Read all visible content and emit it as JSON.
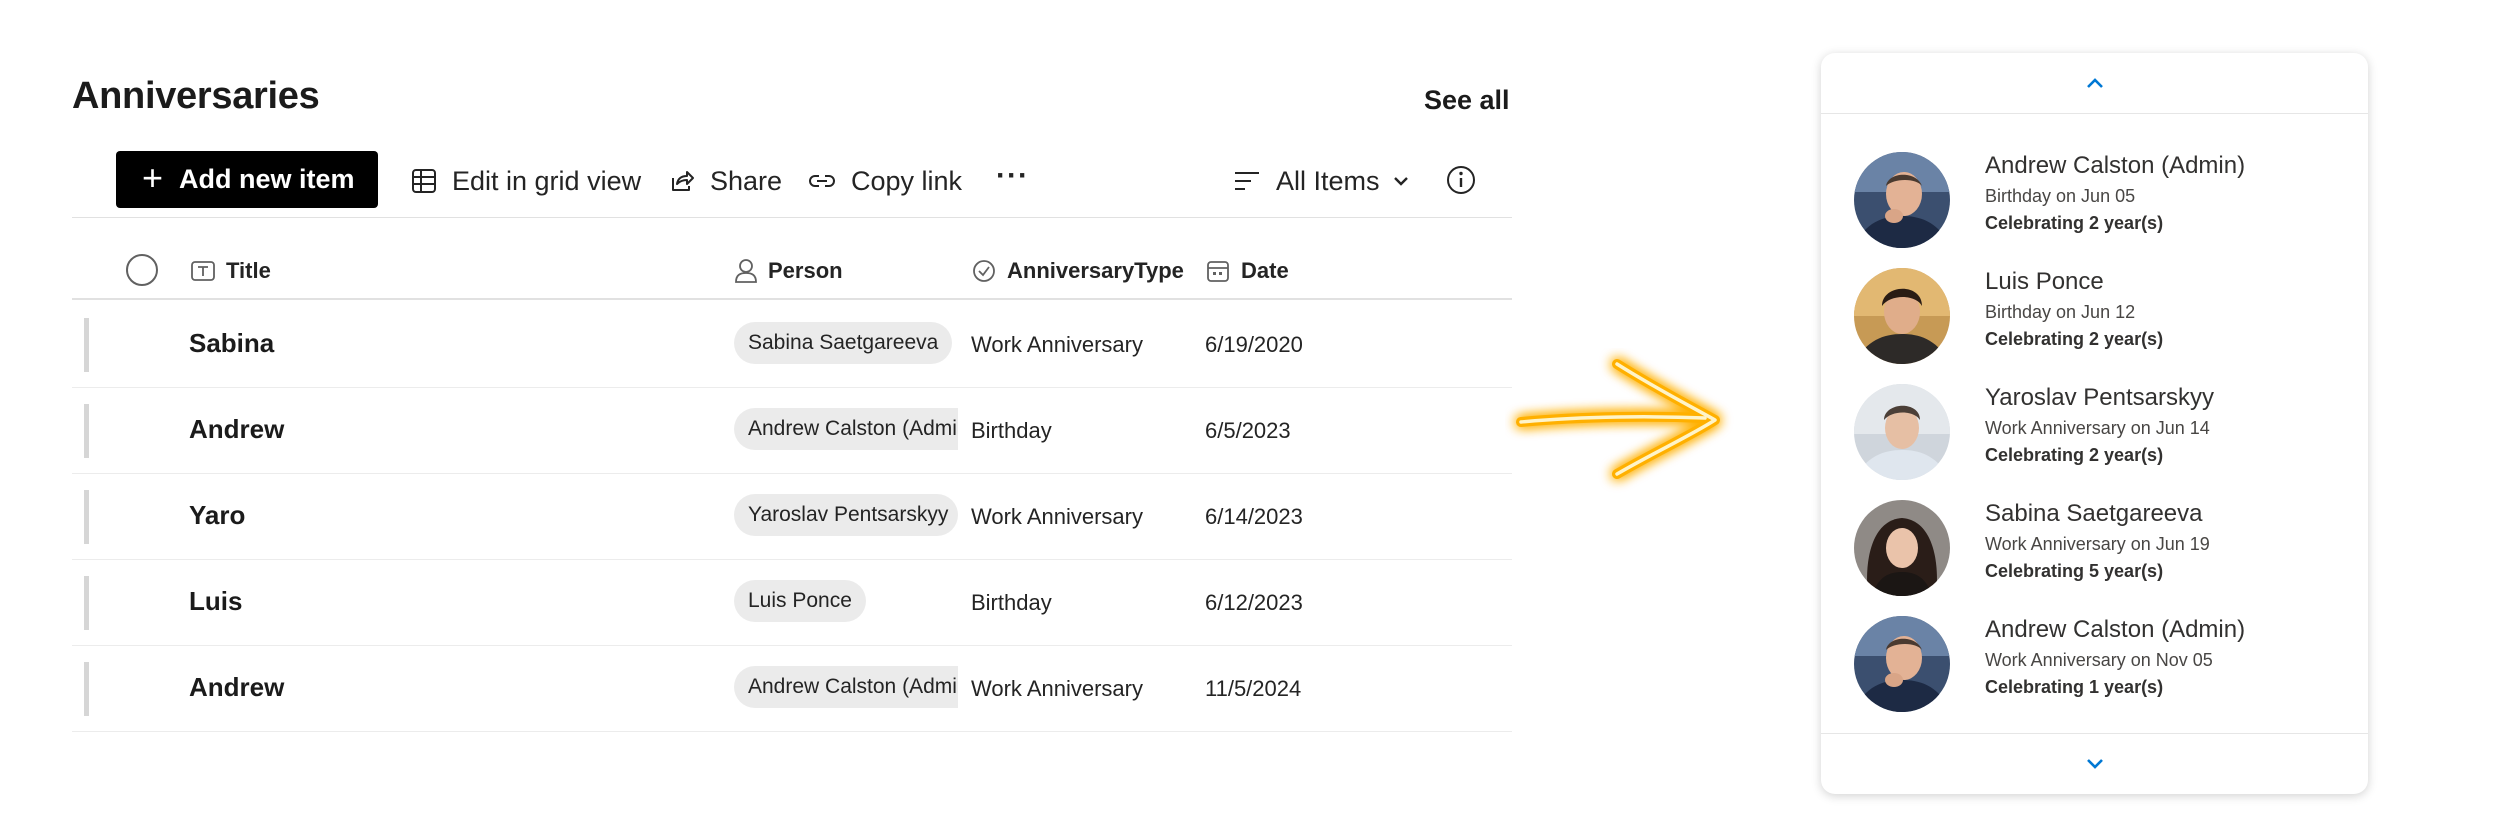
{
  "list": {
    "title": "Anniversaries",
    "see_all": "See all",
    "toolbar": {
      "add": "Add new item",
      "edit_grid": "Edit in grid view",
      "share": "Share",
      "copy_link": "Copy link",
      "more": "···",
      "view": "All Items"
    },
    "columns": {
      "title": "Title",
      "person": "Person",
      "type": "AnniversaryType",
      "date": "Date"
    },
    "rows": [
      {
        "title": "Sabina",
        "person": "Sabina Saetgareeva",
        "type": "Work Anniversary",
        "date": "6/19/2020"
      },
      {
        "title": "Andrew",
        "person": "Andrew Calston (Admin)",
        "type": "Birthday",
        "date": "6/5/2023"
      },
      {
        "title": "Yaro",
        "person": "Yaroslav Pentsarskyy",
        "type": "Work Anniversary",
        "date": "6/14/2023"
      },
      {
        "title": "Luis",
        "person": "Luis Ponce",
        "type": "Birthday",
        "date": "6/12/2023"
      },
      {
        "title": "Andrew",
        "person": "Andrew Calston (Admin)",
        "type": "Work Anniversary",
        "date": "11/5/2024"
      }
    ]
  },
  "card": {
    "people": [
      {
        "name": "Andrew Calston (Admin)",
        "event": "Birthday on Jun 05",
        "celebrating": "Celebrating 2 year(s)"
      },
      {
        "name": "Luis Ponce",
        "event": "Birthday on Jun 12",
        "celebrating": "Celebrating 2 year(s)"
      },
      {
        "name": "Yaroslav Pentsarskyy",
        "event": "Work Anniversary on Jun 14",
        "celebrating": "Celebrating 2 year(s)"
      },
      {
        "name": "Sabina Saetgareeva",
        "event": "Work Anniversary on Jun 19",
        "celebrating": "Celebrating 5 year(s)"
      },
      {
        "name": "Andrew Calston (Admin)",
        "event": "Work Anniversary on Nov 05",
        "celebrating": "Celebrating 1 year(s)"
      }
    ]
  },
  "colors": {
    "accent": "#0078d4",
    "arrow": "#ffb000",
    "primary_button": "#000000"
  },
  "icons": {
    "grid": "grid-icon",
    "share": "share-icon",
    "link": "link-icon",
    "view": "view-lines-icon",
    "info": "info-icon",
    "up": "chevron-up-icon",
    "down": "chevron-down-icon"
  }
}
